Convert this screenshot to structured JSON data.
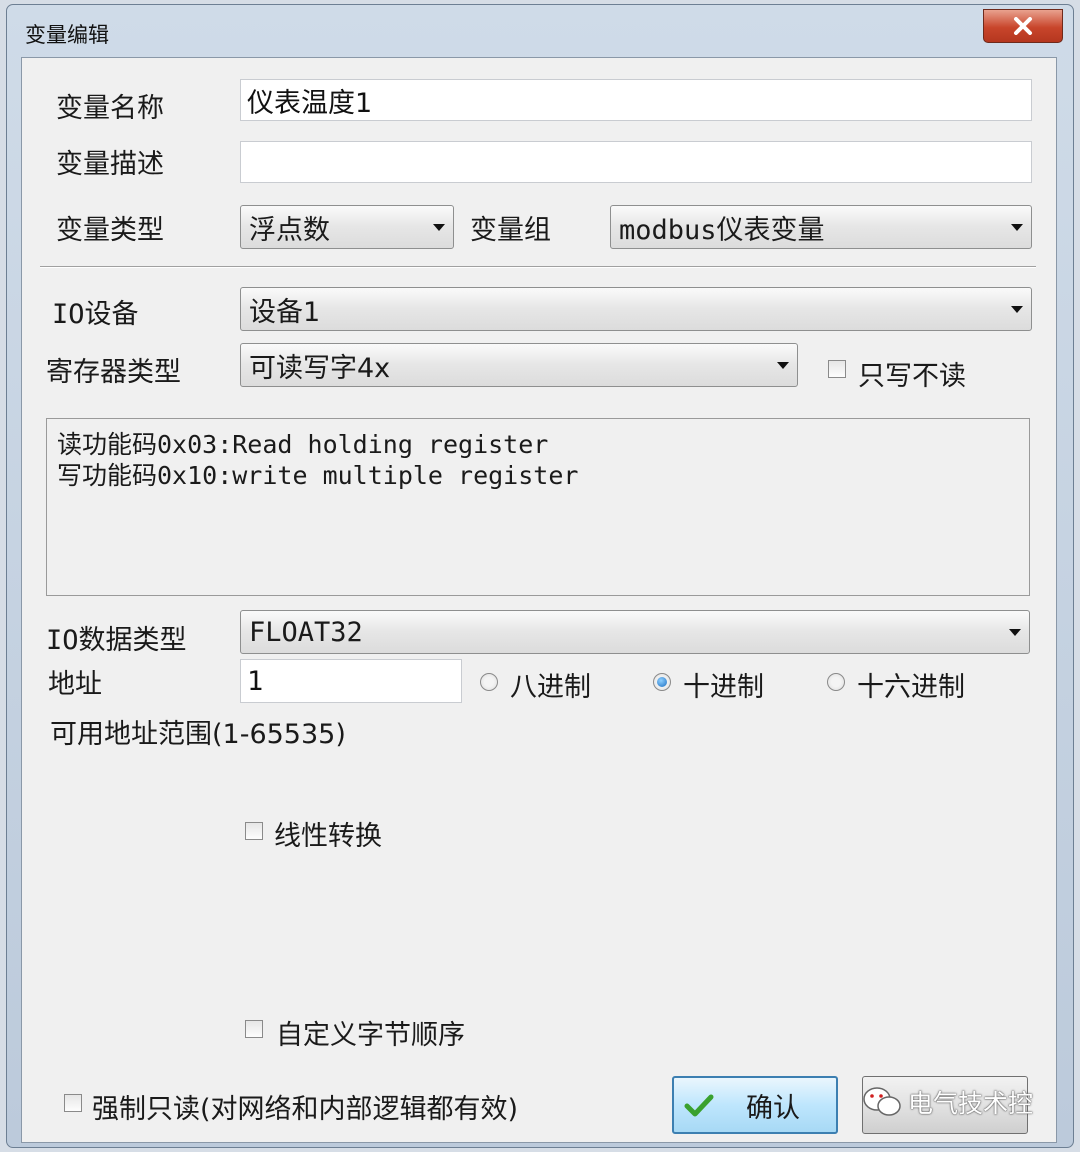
{
  "window": {
    "title": "变量编辑",
    "close_label": "✕"
  },
  "fields": {
    "var_name_label": "变量名称",
    "var_name_value": "仪表温度1",
    "var_desc_label": "变量描述",
    "var_desc_value": "",
    "var_type_label": "变量类型",
    "var_type_value": "浮点数",
    "var_group_label": "变量组",
    "var_group_value": "modbus仪表变量",
    "io_device_label": "IO设备",
    "io_device_value": "设备1",
    "register_type_label": "寄存器类型",
    "register_type_value": "可读写字4x",
    "write_only_label": "只写不读",
    "write_only_checked": false,
    "info_line1": "读功能码0x03:Read holding register",
    "info_line2": "写功能码0x10:write multiple register",
    "io_data_type_label": "IO数据类型",
    "io_data_type_value": "FLOAT32",
    "address_label": "地址",
    "address_value": "1",
    "radix_options": [
      "八进制",
      "十进制",
      "十六进制"
    ],
    "radix_selected": "十进制",
    "address_range": "可用地址范围(1-65535)",
    "linear_label": "线性转换",
    "linear_checked": false,
    "byte_order_label": "自定义字节顺序",
    "byte_order_checked": false,
    "force_readonly_label": "强制只读(对网络和内部逻辑都有效)",
    "force_readonly_checked": false
  },
  "buttons": {
    "ok_label": "确认"
  },
  "watermark": {
    "text": "电气技术控"
  },
  "colors": {
    "ok_check": "#3aa12e",
    "close_red": "#c8452b",
    "radio_selected": "#1d6fc2"
  }
}
